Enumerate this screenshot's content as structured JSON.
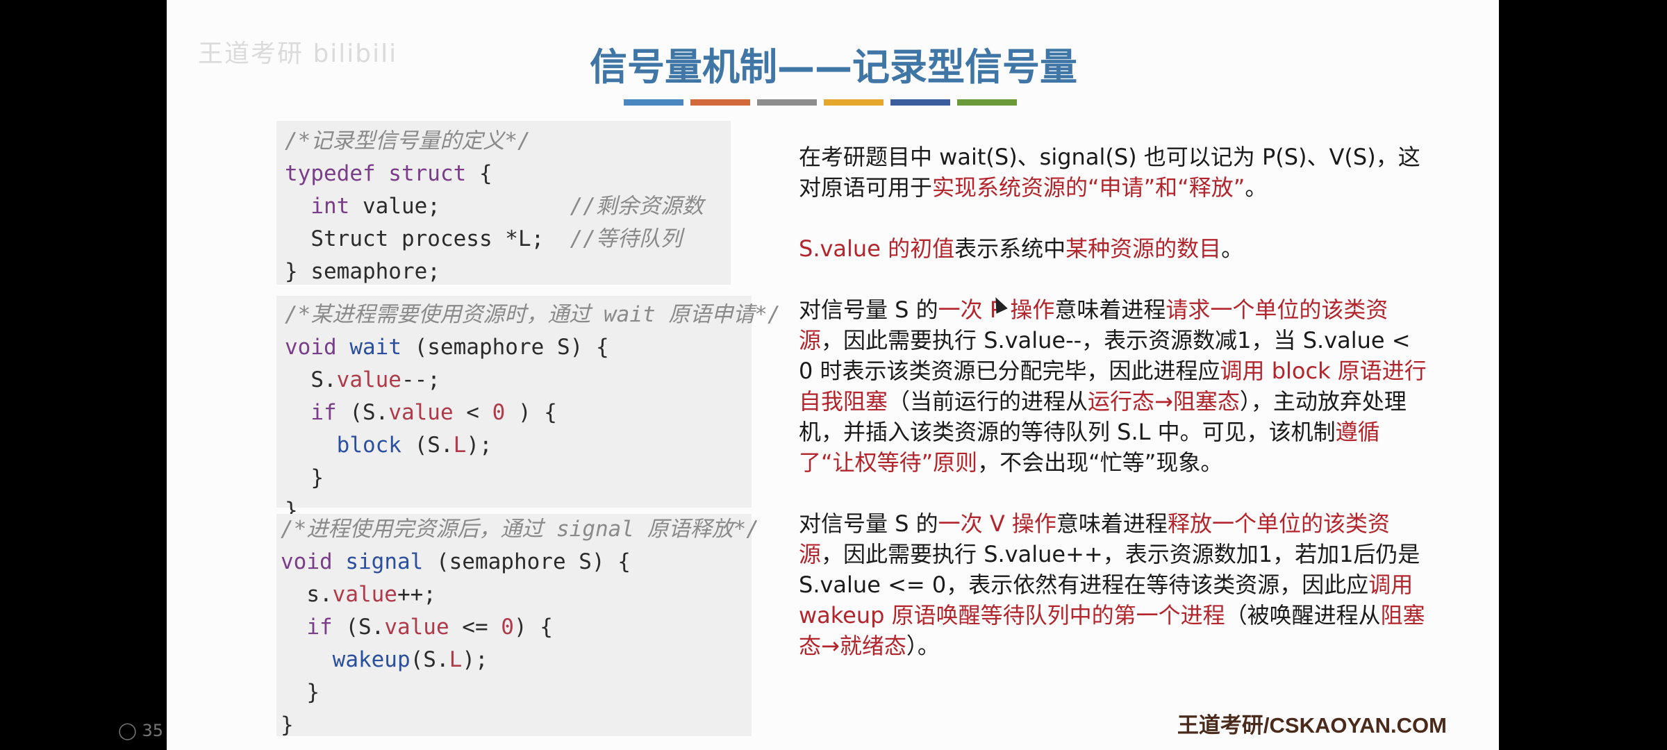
{
  "watermark": "王道考研 bilibili",
  "title": "信号量机制——记录型信号量",
  "title_bar_colors": [
    "#4a86c0",
    "#d2693a",
    "#8d8d8d",
    "#e6a72d",
    "#3b5d9e",
    "#6a9a3a"
  ],
  "code": {
    "block1": [
      [
        {
          "t": "/*记录型信号量的定义*/",
          "c": "cm"
        }
      ],
      [
        {
          "t": "typedef struct",
          "c": "kw"
        },
        {
          "t": " {",
          "c": ""
        }
      ],
      [
        {
          "t": "  ",
          "c": ""
        },
        {
          "t": "int",
          "c": "kw"
        },
        {
          "t": " value;          ",
          "c": ""
        },
        {
          "t": "//剩余资源数",
          "c": "cm"
        }
      ],
      [
        {
          "t": "  Struct process *L;  ",
          "c": ""
        },
        {
          "t": "//等待队列",
          "c": "cm"
        }
      ],
      [
        {
          "t": "} semaphore;",
          "c": ""
        }
      ]
    ],
    "block2": [
      [
        {
          "t": "/*某进程需要使用资源时，通过 wait 原语申请*/",
          "c": "cm"
        }
      ],
      [
        {
          "t": "void",
          "c": "kw"
        },
        {
          "t": " ",
          "c": ""
        },
        {
          "t": "wait",
          "c": "fn"
        },
        {
          "t": " (semaphore S) {",
          "c": ""
        }
      ],
      [
        {
          "t": "  S.",
          "c": ""
        },
        {
          "t": "value",
          "c": "field"
        },
        {
          "t": "--;",
          "c": ""
        }
      ],
      [
        {
          "t": "  ",
          "c": ""
        },
        {
          "t": "if",
          "c": "kw"
        },
        {
          "t": " (S.",
          "c": ""
        },
        {
          "t": "value",
          "c": "field"
        },
        {
          "t": " < ",
          "c": ""
        },
        {
          "t": "0",
          "c": "num"
        },
        {
          "t": " ) {",
          "c": ""
        }
      ],
      [
        {
          "t": "    ",
          "c": ""
        },
        {
          "t": "block",
          "c": "fn"
        },
        {
          "t": " (S.",
          "c": ""
        },
        {
          "t": "L",
          "c": "field"
        },
        {
          "t": ");",
          "c": ""
        }
      ],
      [
        {
          "t": "  }",
          "c": ""
        }
      ],
      [
        {
          "t": "}",
          "c": ""
        }
      ]
    ],
    "block3": [
      [
        {
          "t": "/*进程使用完资源后，通过 signal 原语释放*/",
          "c": "cm"
        }
      ],
      [
        {
          "t": "void",
          "c": "kw"
        },
        {
          "t": " ",
          "c": ""
        },
        {
          "t": "signal",
          "c": "fn"
        },
        {
          "t": " (semaphore S) {",
          "c": ""
        }
      ],
      [
        {
          "t": "  s.",
          "c": ""
        },
        {
          "t": "value",
          "c": "field"
        },
        {
          "t": "++;",
          "c": ""
        }
      ],
      [
        {
          "t": "  ",
          "c": ""
        },
        {
          "t": "if",
          "c": "kw"
        },
        {
          "t": " (S.",
          "c": ""
        },
        {
          "t": "value",
          "c": "field"
        },
        {
          "t": " <= ",
          "c": ""
        },
        {
          "t": "0",
          "c": "num"
        },
        {
          "t": ") {",
          "c": ""
        }
      ],
      [
        {
          "t": "    ",
          "c": ""
        },
        {
          "t": "wakeup",
          "c": "fn"
        },
        {
          "t": "(S.",
          "c": ""
        },
        {
          "t": "L",
          "c": "field"
        },
        {
          "t": ");",
          "c": ""
        }
      ],
      [
        {
          "t": "  }",
          "c": ""
        }
      ],
      [
        {
          "t": "}",
          "c": ""
        }
      ]
    ]
  },
  "paragraphs": [
    [
      {
        "t": "在考研题目中 wait(S)、signal(S)  也可以记为 P(S)、V(S)，这对原语可用于",
        "h": false
      },
      {
        "t": "实现系统资源的“申请”和“释放”",
        "h": true
      },
      {
        "t": "。",
        "h": false
      }
    ],
    [
      {
        "t": "S.value 的初值",
        "h": true
      },
      {
        "t": "表示系统中",
        "h": false
      },
      {
        "t": "某种资源的数目",
        "h": true
      },
      {
        "t": "。",
        "h": false
      }
    ],
    [
      {
        "t": "对信号量 S 的",
        "h": false
      },
      {
        "t": "一次 P 操作",
        "h": true
      },
      {
        "t": "意味着进程",
        "h": false
      },
      {
        "t": "请求一个单位的该类资源",
        "h": true
      },
      {
        "t": "，因此需要执行 S.value--，表示资源数减1，当 S.value < 0 时表示该类资源已分配完毕，因此进程应",
        "h": false
      },
      {
        "t": "调用 block 原语进行自我阻塞",
        "h": true
      },
      {
        "t": "（当前运行的进程从",
        "h": false
      },
      {
        "t": "运行态→阻塞态",
        "h": true
      },
      {
        "t": "），主动放弃处理机，并插入该类资源的等待队列 S.L 中。可见，该机制",
        "h": false
      },
      {
        "t": "遵循了“让权等待”原则",
        "h": true
      },
      {
        "t": "，不会出现“忙等”现象。",
        "h": false
      }
    ],
    [
      {
        "t": "对信号量 S 的",
        "h": false
      },
      {
        "t": "一次 V 操作",
        "h": true
      },
      {
        "t": "意味着进程",
        "h": false
      },
      {
        "t": "释放一个单位的该类资源",
        "h": true
      },
      {
        "t": "，因此需要执行 S.value++，表示资源数加1，若加1后仍是 S.value <= 0，表示依然有进程在等待该类资源，因此应",
        "h": false
      },
      {
        "t": "调用 wakeup 原语唤醒等待队列中的第一个进程",
        "h": true
      },
      {
        "t": "（被唤醒进程从",
        "h": false
      },
      {
        "t": "阻塞态→就绪态",
        "h": true
      },
      {
        "t": "）。",
        "h": false
      }
    ]
  ],
  "footer": "王道考研/CSKAOYAN.COM",
  "viewer_count": "35"
}
